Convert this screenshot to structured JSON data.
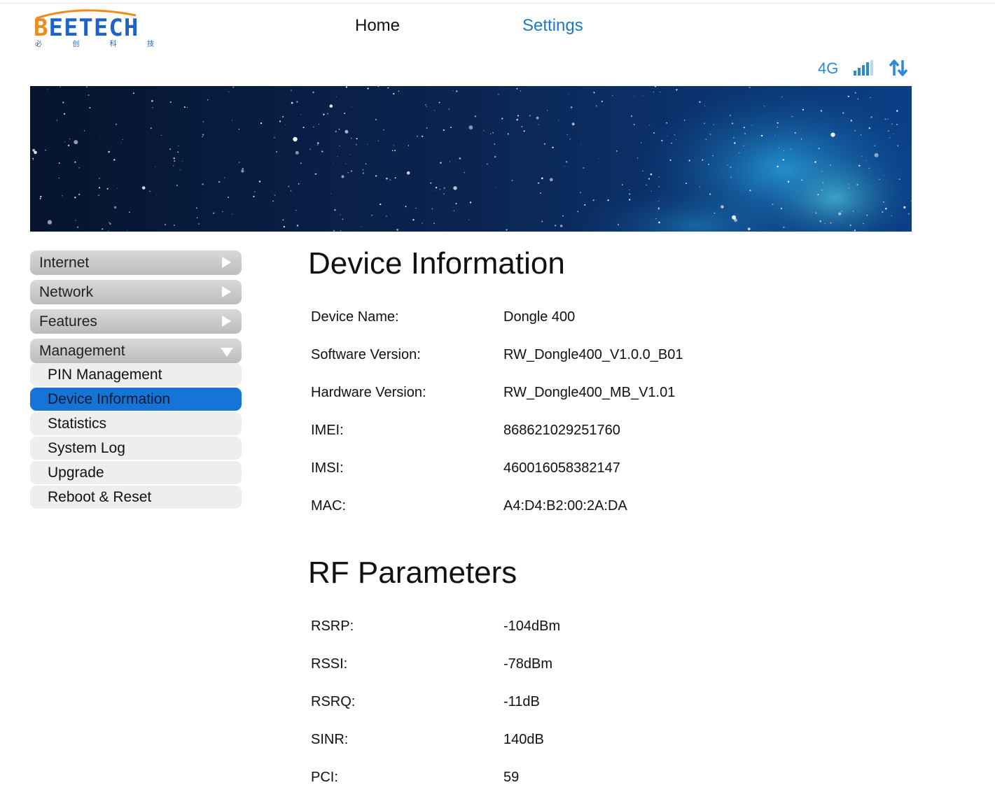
{
  "logo": {
    "brand_first": "B",
    "brand_rest": "EETECH",
    "subtitle": [
      "必",
      "创",
      "科",
      "技"
    ]
  },
  "nav": {
    "home": "Home",
    "settings": "Settings"
  },
  "status": {
    "network_type": "4G",
    "signal_icon": "signal-bars-icon",
    "data_icon": "up-down-arrows-icon",
    "accent": "#2b8ad8"
  },
  "sidebar": {
    "categories": [
      {
        "label": "Internet",
        "icon": "chevron-right-icon"
      },
      {
        "label": "Network",
        "icon": "chevron-right-icon"
      },
      {
        "label": "Features",
        "icon": "chevron-right-icon"
      },
      {
        "label": "Management",
        "icon": "chevron-down-icon"
      }
    ],
    "management_items": [
      {
        "label": "PIN Management"
      },
      {
        "label": "Device Information",
        "active": true
      },
      {
        "label": "Statistics"
      },
      {
        "label": "System Log"
      },
      {
        "label": "Upgrade"
      },
      {
        "label": "Reboot & Reset"
      }
    ],
    "active_color": "#1574d6"
  },
  "device_info": {
    "title": "Device Information",
    "rows": [
      {
        "label": "Device Name:",
        "value": "Dongle 400"
      },
      {
        "label": "Software Version:",
        "value": "RW_Dongle400_V1.0.0_B01"
      },
      {
        "label": "Hardware Version:",
        "value": "RW_Dongle400_MB_V1.01"
      },
      {
        "label": "IMEI:",
        "value": "868621029251760"
      },
      {
        "label": "IMSI:",
        "value": "460016058382147"
      },
      {
        "label": "MAC:",
        "value": "A4:D4:B2:00:2A:DA"
      }
    ]
  },
  "rf_parameters": {
    "title": "RF Parameters",
    "rows": [
      {
        "label": "RSRP:",
        "value": "-104dBm"
      },
      {
        "label": "RSSI:",
        "value": "-78dBm"
      },
      {
        "label": "RSRQ:",
        "value": "-11dB"
      },
      {
        "label": "SINR:",
        "value": "140dB"
      },
      {
        "label": "PCI:",
        "value": "59"
      }
    ]
  }
}
